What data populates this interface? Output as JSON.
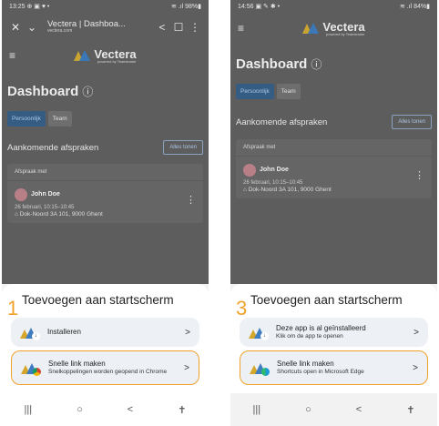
{
  "left": {
    "status": {
      "time": "13:25 ⊕ ▣ ♥ •",
      "right": "≋ .ıl 98%▮"
    },
    "browser": {
      "title": "Vectera | Dashboa...",
      "url": "vectera.com"
    },
    "logo": {
      "name": "Vectera",
      "sub": "powered by Teamleader"
    },
    "dashboard": {
      "title": "Dashboard",
      "info": "ⓘ"
    },
    "tabs": [
      "Persoonlijk",
      "Team"
    ],
    "section": {
      "label": "Aankomende afspraken",
      "show_all": "Alles tonen"
    },
    "card": {
      "head": "Afspraak met",
      "name": "John Doe",
      "date": "26 februari, 10:15–10:45",
      "address": "Dok-Noord 3A 101, 9000 Ghent"
    },
    "sheet": {
      "step": "1",
      "title": "Toevoegen aan startscherm",
      "options": [
        {
          "line1": "Installeren",
          "line2": ""
        },
        {
          "line1": "Snelle link maken",
          "line2": "Snelkoppelingen worden geopend in Chrome"
        }
      ]
    }
  },
  "right": {
    "status": {
      "time": "14:56 ▣ ✎ ✱ •",
      "right": "≋ .ıl 84%▮"
    },
    "logo": {
      "name": "Vectera",
      "sub": "powered by Teamleader"
    },
    "dashboard": {
      "title": "Dashboard",
      "info": "ⓘ"
    },
    "tabs": [
      "Persoonlijk",
      "Team"
    ],
    "section": {
      "label": "Aankomende afspraken",
      "show_all": "Alles tonen"
    },
    "card": {
      "head": "Afspraak met",
      "name": "John Doe",
      "date": "26 februari, 10:15–10:45",
      "address": "Dok-Noord 3A 101, 9000 Ghent"
    },
    "sheet": {
      "step": "3",
      "title": "Toevoegen aan startscherm",
      "options": [
        {
          "line1": "Deze app is al geïnstalleerd",
          "line2": "Klik om de app te openen"
        },
        {
          "line1": "Snelle link maken",
          "line2": "Shortcuts open in Microsoft Edge"
        }
      ]
    }
  },
  "nav": {
    "recents": "|||",
    "home": "○",
    "back": "<",
    "accessibility": "✝"
  },
  "colors": {
    "highlight": "#f0a12c",
    "primary": "#355d84",
    "option_bg": "#edf1f6"
  }
}
